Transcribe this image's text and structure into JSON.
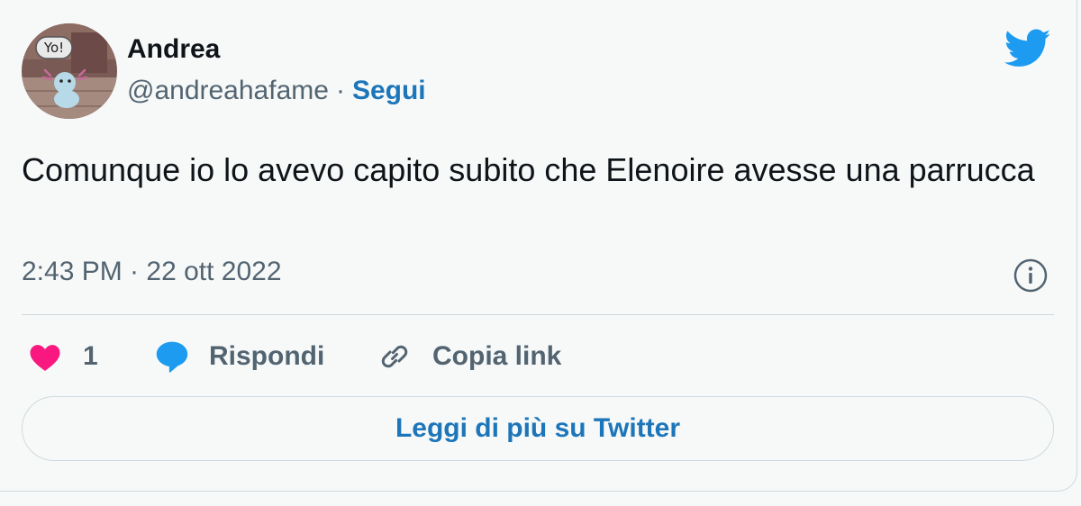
{
  "author": {
    "name": "Andrea",
    "handle": "@andreahafame",
    "separator": "·",
    "follow_label": "Segui",
    "avatar_badge_text": "Yo!"
  },
  "tweet": {
    "text": "Comunque io lo avevo capito subito che Elenoire avesse una parrucca",
    "timestamp": "2:43 PM · 22 ott 2022"
  },
  "actions": {
    "like_count": "1",
    "reply_label": "Rispondi",
    "copy_link_label": "Copia link"
  },
  "footer": {
    "read_more_label": "Leggi di più su Twitter"
  },
  "icons": {
    "logo": "twitter-bird-icon",
    "info": "info-icon",
    "like": "heart-icon",
    "reply": "speech-bubble-icon",
    "copy": "link-icon"
  },
  "colors": {
    "twitter_blue": "#1d9bf0",
    "link_blue": "#1d76b9",
    "like_pink": "#f91880",
    "text": "#0f1419",
    "secondary": "#536471",
    "border": "#cfd9de",
    "background": "#f7f9f9"
  }
}
